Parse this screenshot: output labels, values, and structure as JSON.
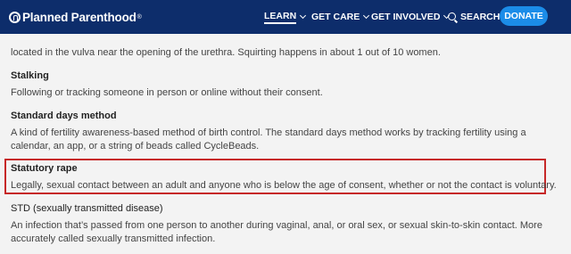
{
  "nav": {
    "logo": "Planned Parenthood",
    "logo_tm": "®",
    "learn": "LEARN",
    "get_care": "GET CARE",
    "get_involved": "GET INVOLVED",
    "search": "SEARCH",
    "donate": "DONATE"
  },
  "entries": [
    {
      "term": "",
      "lines": [
        "located in the vulva near the opening of the urethra. Squirting happens in about 1 out of 10 women."
      ]
    },
    {
      "term": "Stalking",
      "lines": [
        "Following or tracking someone in person or online without their consent."
      ]
    },
    {
      "term": "Standard days method",
      "lines": [
        "A kind of fertility awareness-based method of birth control. The standard days method works by tracking fertility using a",
        "calendar, an app, or a string of beads called CycleBeads."
      ]
    },
    {
      "term": "Statutory rape",
      "lines": [
        "Legally, sexual contact between an adult and anyone who is below the age of consent, whether or not the contact is voluntary."
      ]
    },
    {
      "term": "STD (sexually transmitted disease)",
      "lines": [
        "An infection that’s passed from one person to another during vaginal, anal, or oral sex, or sexual skin-to-skin contact. More",
        "accurately called sexually transmitted infection."
      ]
    }
  ],
  "colors": {
    "nav_bg": "#0d2d6b",
    "donate_bg": "#1b8ce8",
    "page_bg": "#f3f3f3",
    "highlight_border": "#c62828"
  }
}
